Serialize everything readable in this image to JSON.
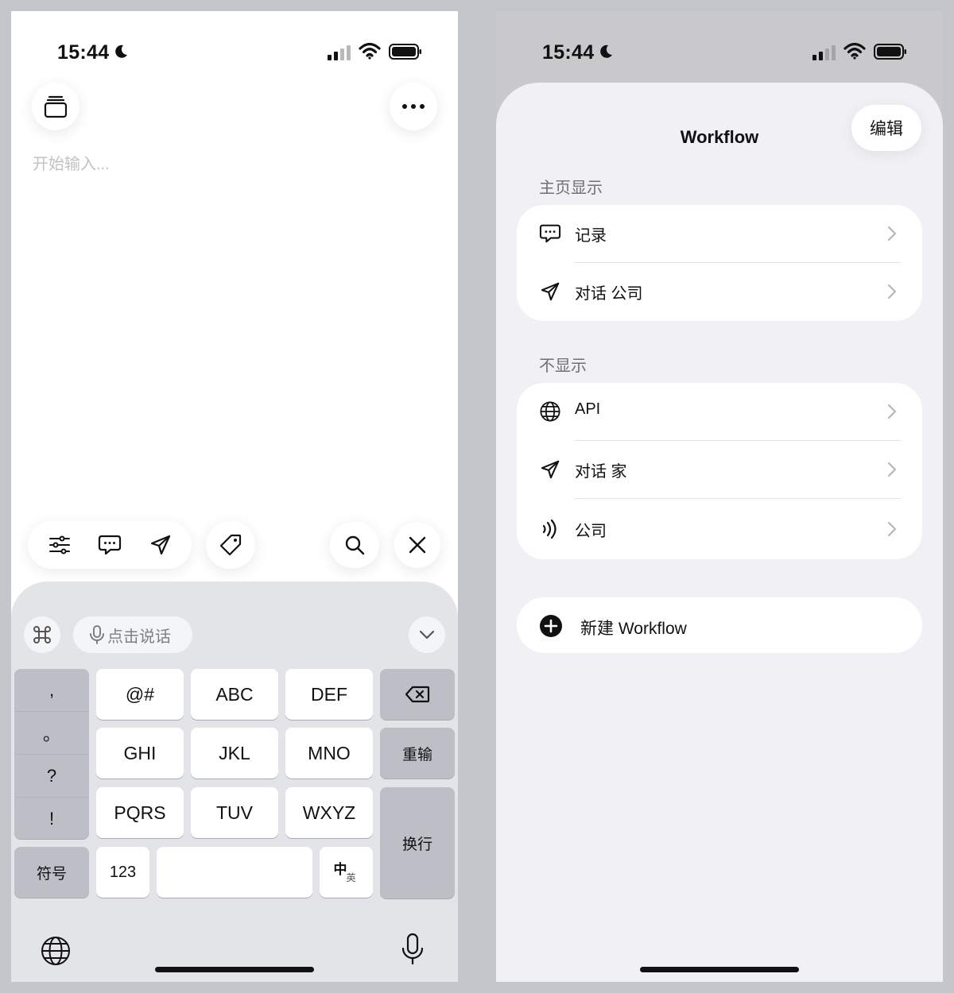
{
  "left_screen": {
    "status_bar": {
      "time": "15:44"
    },
    "editor": {
      "placeholder": "开始输入..."
    },
    "toolbar": {
      "icons": [
        "sliders-icon",
        "chat-bubble-icon",
        "send-icon",
        "tag-icon",
        "search-icon",
        "close-icon"
      ]
    },
    "keyboard": {
      "voice_input": "点击说话",
      "punctuation": [
        ",",
        "。",
        "?",
        "!"
      ],
      "symbols_key": "符号",
      "rows": [
        [
          "@#",
          "ABC",
          "DEF"
        ],
        [
          "GHI",
          "JKL",
          "MNO"
        ],
        [
          "PQRS",
          "TUV",
          "WXYZ"
        ]
      ],
      "retype_key": "重输",
      "newline_key": "换行",
      "numbers_key": "123",
      "lang_switch": {
        "main": "中",
        "sub": "英"
      }
    }
  },
  "right_screen": {
    "status_bar": {
      "time": "15:44"
    },
    "sheet": {
      "title": "Workflow",
      "edit_button": "编辑",
      "shown_section": {
        "label": "主页显示",
        "items": [
          {
            "label": "记录",
            "icon": "chat-bubble-icon"
          },
          {
            "label": "对话 公司",
            "icon": "send-icon"
          }
        ]
      },
      "hidden_section": {
        "label": "不显示",
        "items": [
          {
            "label": "API",
            "icon": "globe-icon"
          },
          {
            "label": "对话 家",
            "icon": "send-icon"
          },
          {
            "label": "公司",
            "icon": "wave-icon"
          }
        ]
      },
      "new_button": "新建 Workflow"
    }
  }
}
